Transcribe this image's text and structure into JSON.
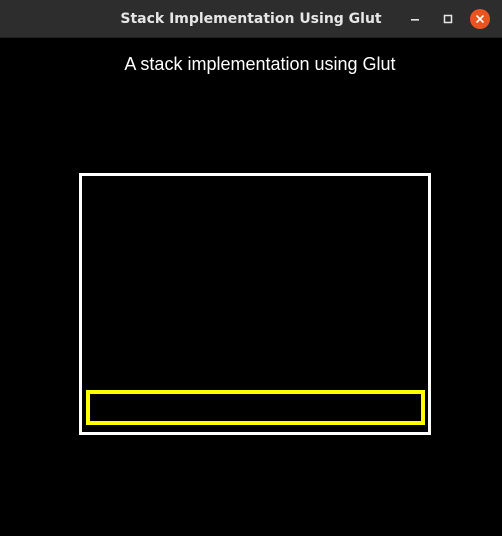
{
  "window": {
    "title": "Stack Implementation Using Glut"
  },
  "canvas": {
    "heading": "A stack implementation using Glut",
    "stack": {
      "border_color": "#ffffff",
      "element_color": "#ffff00",
      "element_count": 1
    }
  },
  "controls": {
    "minimize_icon": "minimize-icon",
    "maximize_icon": "maximize-icon",
    "close_icon": "close-icon",
    "close_color": "#e95420"
  }
}
